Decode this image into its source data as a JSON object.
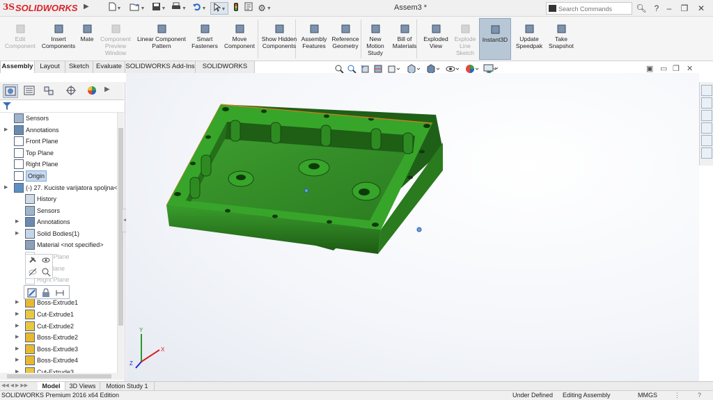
{
  "app": {
    "brand": "SOLIDWORKS",
    "document_title": "Assem3 *"
  },
  "search": {
    "placeholder": "Search Commands"
  },
  "command_manager": [
    {
      "label": "Edit Component",
      "disabled": true,
      "icon": "edit-component-icon"
    },
    {
      "label": "Insert Components",
      "disabled": false,
      "icon": "insert-components-icon"
    },
    {
      "label": "Mate",
      "disabled": false,
      "icon": "mate-icon"
    },
    {
      "label": "Component Preview Window",
      "disabled": true,
      "icon": "component-preview-icon"
    },
    {
      "label": "Linear Component Pattern",
      "disabled": false,
      "icon": "linear-pattern-icon"
    },
    {
      "label": "Smart Fasteners",
      "disabled": false,
      "icon": "smart-fasteners-icon"
    },
    {
      "label": "Move Component",
      "disabled": false,
      "icon": "move-component-icon"
    },
    {
      "label": "Show Hidden Components",
      "disabled": false,
      "icon": "show-hidden-icon"
    },
    {
      "label": "Assembly Features",
      "disabled": false,
      "icon": "assembly-features-icon"
    },
    {
      "label": "Reference Geometry",
      "disabled": false,
      "icon": "reference-geometry-icon"
    },
    {
      "label": "New Motion Study",
      "disabled": false,
      "icon": "motion-study-icon"
    },
    {
      "label": "Bill of Materials",
      "disabled": false,
      "icon": "bom-icon"
    },
    {
      "label": "Exploded View",
      "disabled": false,
      "icon": "exploded-view-icon"
    },
    {
      "label": "Explode Line Sketch",
      "disabled": true,
      "icon": "explode-line-icon"
    },
    {
      "label": "Instant3D",
      "disabled": false,
      "active": true,
      "icon": "instant3d-icon"
    },
    {
      "label": "Update Speedpak",
      "disabled": false,
      "icon": "speedpak-icon"
    },
    {
      "label": "Take Snapshot",
      "disabled": false,
      "icon": "snapshot-icon"
    }
  ],
  "tabs": [
    "Assembly",
    "Layout",
    "Sketch",
    "Evaluate",
    "SOLIDWORKS Add-Ins",
    "SOLIDWORKS MBD"
  ],
  "active_tab": "Assembly",
  "feature_tree": [
    {
      "label": "Sensors",
      "indent": 0,
      "expand": false,
      "icon": "sensor-icon"
    },
    {
      "label": "Annotations",
      "indent": 0,
      "expand": true,
      "icon": "annotations-icon"
    },
    {
      "label": "Front Plane",
      "indent": 0,
      "expand": false,
      "icon": "plane-icon"
    },
    {
      "label": "Top Plane",
      "indent": 0,
      "expand": false,
      "icon": "plane-icon"
    },
    {
      "label": "Right Plane",
      "indent": 0,
      "expand": false,
      "icon": "plane-icon"
    },
    {
      "label": "Origin",
      "indent": 0,
      "expand": false,
      "icon": "origin-icon",
      "selected": true
    },
    {
      "label": "(-) 27. Kuciste varijatora spoljna<",
      "indent": 0,
      "expand": true,
      "icon": "part-icon"
    },
    {
      "label": "History",
      "indent": 1,
      "expand": false,
      "icon": "history-icon"
    },
    {
      "label": "Sensors",
      "indent": 1,
      "expand": false,
      "icon": "sensor-icon"
    },
    {
      "label": "Annotations",
      "indent": 1,
      "expand": true,
      "icon": "annotations-icon"
    },
    {
      "label": "Solid Bodies(1)",
      "indent": 1,
      "expand": true,
      "icon": "solid-bodies-icon"
    },
    {
      "label": "Material <not specified>",
      "indent": 1,
      "expand": false,
      "icon": "material-icon"
    },
    {
      "label": "Front Plane",
      "indent": 1,
      "expand": false,
      "icon": "plane-icon",
      "ghost": true
    },
    {
      "label": "Top Plane",
      "indent": 1,
      "expand": false,
      "icon": "plane-icon",
      "ghost": true
    },
    {
      "label": "Right Plane",
      "indent": 1,
      "expand": false,
      "icon": "plane-icon",
      "ghost": true
    },
    {
      "label": "Origin",
      "indent": 1,
      "expand": false,
      "icon": "origin-icon",
      "ghost": true
    },
    {
      "label": "Boss-Extrude1",
      "indent": 1,
      "expand": true,
      "icon": "boss-extrude-icon"
    },
    {
      "label": "Cut-Extrude1",
      "indent": 1,
      "expand": true,
      "icon": "cut-extrude-icon"
    },
    {
      "label": "Cut-Extrude2",
      "indent": 1,
      "expand": true,
      "icon": "cut-extrude-icon"
    },
    {
      "label": "Boss-Extrude2",
      "indent": 1,
      "expand": true,
      "icon": "boss-extrude-icon"
    },
    {
      "label": "Boss-Extrude3",
      "indent": 1,
      "expand": true,
      "icon": "boss-extrude-icon"
    },
    {
      "label": "Boss-Extrude4",
      "indent": 1,
      "expand": true,
      "icon": "boss-extrude-icon"
    },
    {
      "label": "Cut-Extrude3",
      "indent": 1,
      "expand": true,
      "icon": "cut-extrude-icon"
    }
  ],
  "bottom_tabs": [
    "Model",
    "3D Views",
    "Motion Study 1"
  ],
  "active_bottom_tab": "Model",
  "status": {
    "edition": "SOLIDWORKS Premium 2016 x64 Edition",
    "definition": "Under Defined",
    "mode": "Editing Assembly",
    "units": "MMGS"
  },
  "triad_labels": {
    "x": "X",
    "y": "Y",
    "z": "Z"
  },
  "colors": {
    "part_green": "#2e8b22",
    "part_dark": "#1f5f17",
    "brand_red": "#d8232a",
    "active_button": "#b8c7d6"
  }
}
